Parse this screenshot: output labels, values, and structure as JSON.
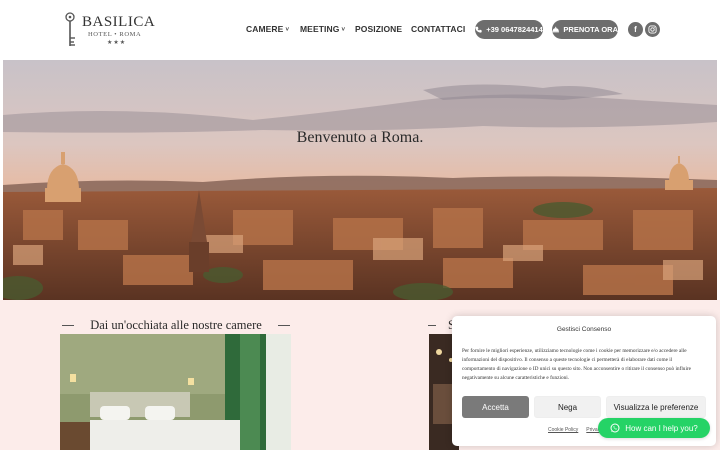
{
  "brand": {
    "name": "BASILICA",
    "subtitle": "HOTEL • ROMA",
    "stars": "★★★"
  },
  "nav": {
    "items": [
      {
        "label": "CAMERE",
        "has_dropdown": true
      },
      {
        "label": "MEETING",
        "has_dropdown": true
      },
      {
        "label": "POSIZIONE",
        "has_dropdown": false
      },
      {
        "label": "CONTATTACI",
        "has_dropdown": false
      }
    ],
    "phone_label": "+39 0647824414",
    "book_label": "PRENOTA ORA",
    "social": {
      "facebook": "f",
      "instagram": "◎"
    }
  },
  "hero": {
    "title": "Benvenuto a Roma."
  },
  "rooms": {
    "heading": "Dai un'occhiata alle nostre camere",
    "right_heading_fragment": "S"
  },
  "consent": {
    "title": "Gestisci Consenso",
    "text": "Per fornire le migliori esperienze, utilizziamo tecnologie come i cookie per memorizzare e/o accedere alle informazioni del dispositivo. Il consenso a queste tecnologie ci permetterà di elaborare dati come il comportamento di navigazione o ID unici su questo sito. Non acconsentire o ritirare il consenso può influire negativamente su alcune caratteristiche e funzioni.",
    "accept_label": "Accetta",
    "deny_label": "Nega",
    "prefs_label": "Visualizza le preferenze",
    "link_cookie": "Cookie Policy",
    "link_privacy": "Privac"
  },
  "whatsapp": {
    "label": "How can I help you?"
  },
  "colors": {
    "pill": "#6d6d6d",
    "whatsapp": "#25d366",
    "section_bg": "#fcecea",
    "accept_btn": "#7a7a7a"
  }
}
